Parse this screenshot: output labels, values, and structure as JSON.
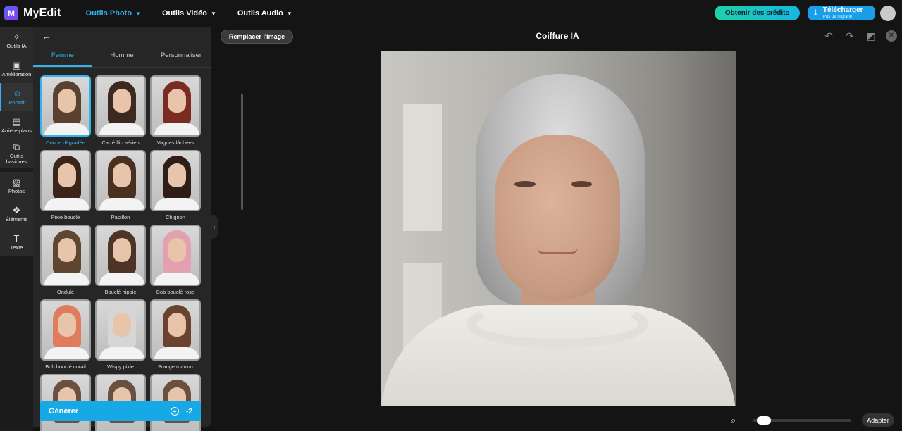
{
  "app": {
    "logo_letter": "M",
    "name": "MyEdit"
  },
  "nav": [
    {
      "label": "Outils Photo",
      "active": true
    },
    {
      "label": "Outils Vidéo",
      "active": false
    },
    {
      "label": "Outils Audio",
      "active": false
    }
  ],
  "header": {
    "credits_label": "Obtenir des crédits",
    "download_label": "Télécharger",
    "download_sublabel": "Pas de filigrane"
  },
  "rail": [
    {
      "label": "Outils IA",
      "icon": "magic-wand-icon"
    },
    {
      "label": "Amélioration",
      "icon": "enhance-icon"
    },
    {
      "label": "Portrait",
      "icon": "portrait-icon",
      "active": true
    },
    {
      "label": "Arrière-plans",
      "icon": "background-icon"
    },
    {
      "label": "Outils basiques",
      "icon": "crop-icon"
    },
    {
      "label": "Photos",
      "icon": "photos-icon"
    },
    {
      "label": "Éléments",
      "icon": "elements-icon"
    },
    {
      "label": "Texte",
      "icon": "text-icon"
    }
  ],
  "panel": {
    "tabs": [
      "Femme",
      "Homme",
      "Personnaliser"
    ],
    "active_tab": 0,
    "styles": [
      {
        "label": "Coupe dégradée",
        "hair": "#5a4030",
        "selected": true
      },
      {
        "label": "Carré flip aérien",
        "hair": "#3a2a20"
      },
      {
        "label": "Vagues lâchées",
        "hair": "#7a2c22"
      },
      {
        "label": "Pixie bouclé",
        "hair": "#3b2418"
      },
      {
        "label": "Papillon",
        "hair": "#4a3020"
      },
      {
        "label": "Chignon",
        "hair": "#2e1e16"
      },
      {
        "label": "Ondulé",
        "hair": "#5e4630"
      },
      {
        "label": "Bouclé hippie",
        "hair": "#4e3426"
      },
      {
        "label": "Bob bouclé rose",
        "hair": "#e4a0b0"
      },
      {
        "label": "Bob bouclé corail",
        "hair": "#e07c5e"
      },
      {
        "label": "Wispy pixie",
        "hair": "#d6d6d6"
      },
      {
        "label": "Frange marron",
        "hair": "#6a4230"
      }
    ],
    "generate_label": "Générer",
    "generate_cost": "-2"
  },
  "canvas": {
    "replace_label": "Remplacer l'image",
    "title": "Coiffure IA",
    "fit_label": "Adapter",
    "zoom_level": 0.05
  }
}
